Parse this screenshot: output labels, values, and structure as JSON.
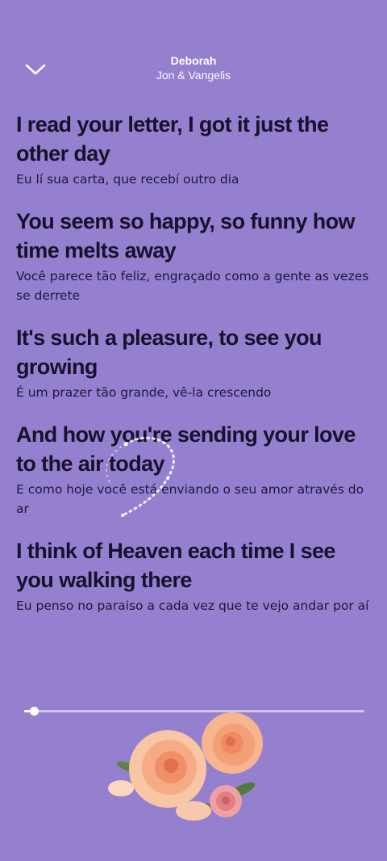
{
  "header": {
    "title": "Deborah",
    "artist": "Jon & Vangelis"
  },
  "icons": {
    "collapse": "chevron-down-icon",
    "decoration": "flowers-sticker"
  },
  "lyrics": [
    {
      "original": "I read your letter, I got it just the other day",
      "translation": "Eu lí sua carta, que recebí outro dia"
    },
    {
      "original": "You seem so happy, so funny how time melts away",
      "translation": "Você parece tão feliz, engraçado como a gente as vezes se derrete"
    },
    {
      "original": "It's such a pleasure, to see you growing",
      "translation": "É um prazer tão grande, vê-la crescendo"
    },
    {
      "original": "And how you're sending your love to the air today",
      "translation": "E como hoje você está enviando o seu amor através do ar"
    },
    {
      "original": "I think of Heaven each time I see you walking there",
      "translation": "Eu penso no paraiso a cada vez que te vejo andar por aí"
    }
  ],
  "playback": {
    "progress_fraction": 0.03
  },
  "colors": {
    "background": "#9480cf",
    "lyric_text": "#17122c",
    "header_text": "#ffffff"
  }
}
